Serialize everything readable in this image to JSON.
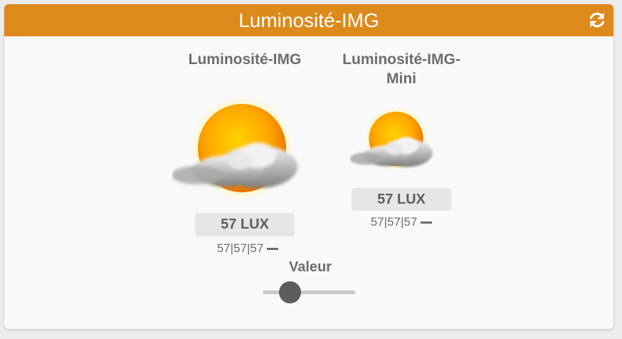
{
  "header": {
    "title": "Luminosité-IMG",
    "color": "#dd8a1c",
    "icon": "refresh-icon"
  },
  "widgets": [
    {
      "title": "Luminosité-IMG",
      "icon": "weather-sun-cloud-icon",
      "value": "57 LUX",
      "stats": "57|57|57"
    },
    {
      "title_line1": "Luminosité-IMG-",
      "title_line2": "Mini",
      "icon": "weather-sun-cloud-icon",
      "value": "57 LUX",
      "stats": "57|57|57"
    }
  ],
  "slider": {
    "label": "Valeur"
  }
}
